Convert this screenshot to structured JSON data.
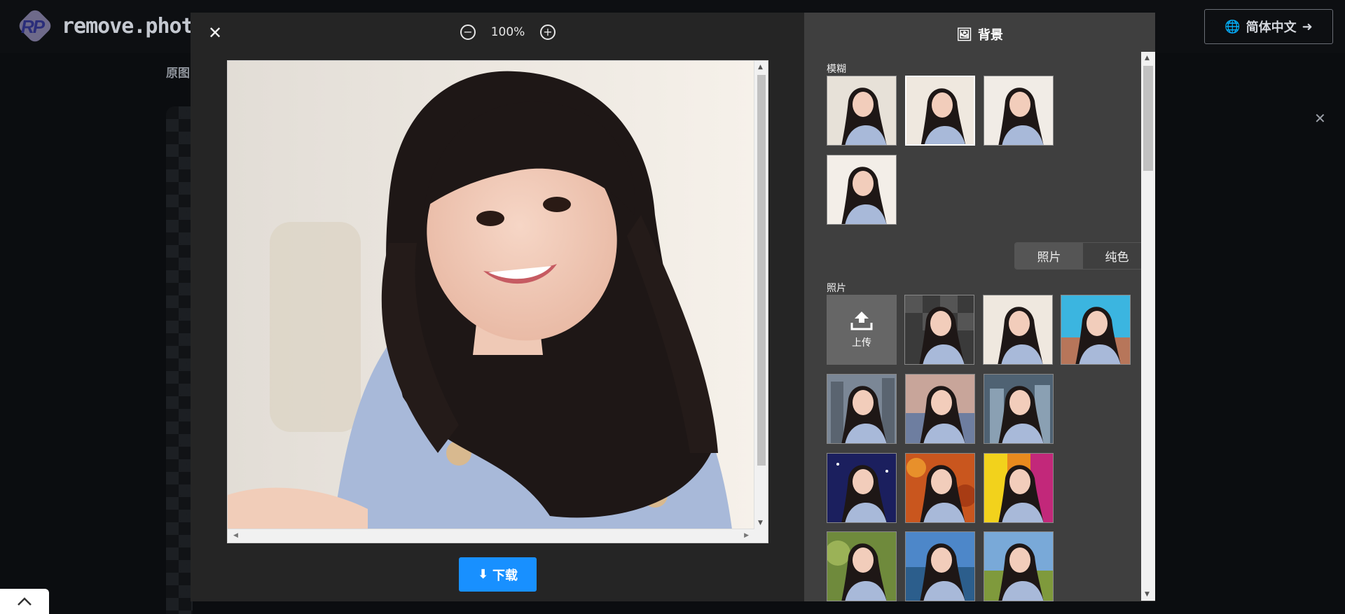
{
  "site": {
    "logo_letters": "RP",
    "logo_text": "remove.photos",
    "language": "简体中文",
    "page_label": "原图"
  },
  "modal": {
    "zoom_level": "100%",
    "download_label": "下载"
  },
  "panel": {
    "title": "背景",
    "blur_label": "模糊",
    "tabs": [
      {
        "label": "照片",
        "active": true
      },
      {
        "label": "纯色",
        "active": false
      }
    ],
    "photo_label": "照片",
    "upload_label": "上传"
  },
  "icons": {
    "close": "close-icon",
    "zoom_out": "zoom-out-icon",
    "zoom_in": "zoom-in-icon",
    "download": "download-icon",
    "background": "image-stack-icon",
    "globe": "globe-icon",
    "arrow_right": "arrow-right-icon",
    "upload": "upload-icon",
    "chevron_up": "chevron-up-icon"
  },
  "colors": {
    "accent": "#1890ff",
    "modal_bg": "#252525",
    "panel_bg": "#3f3f3f"
  }
}
